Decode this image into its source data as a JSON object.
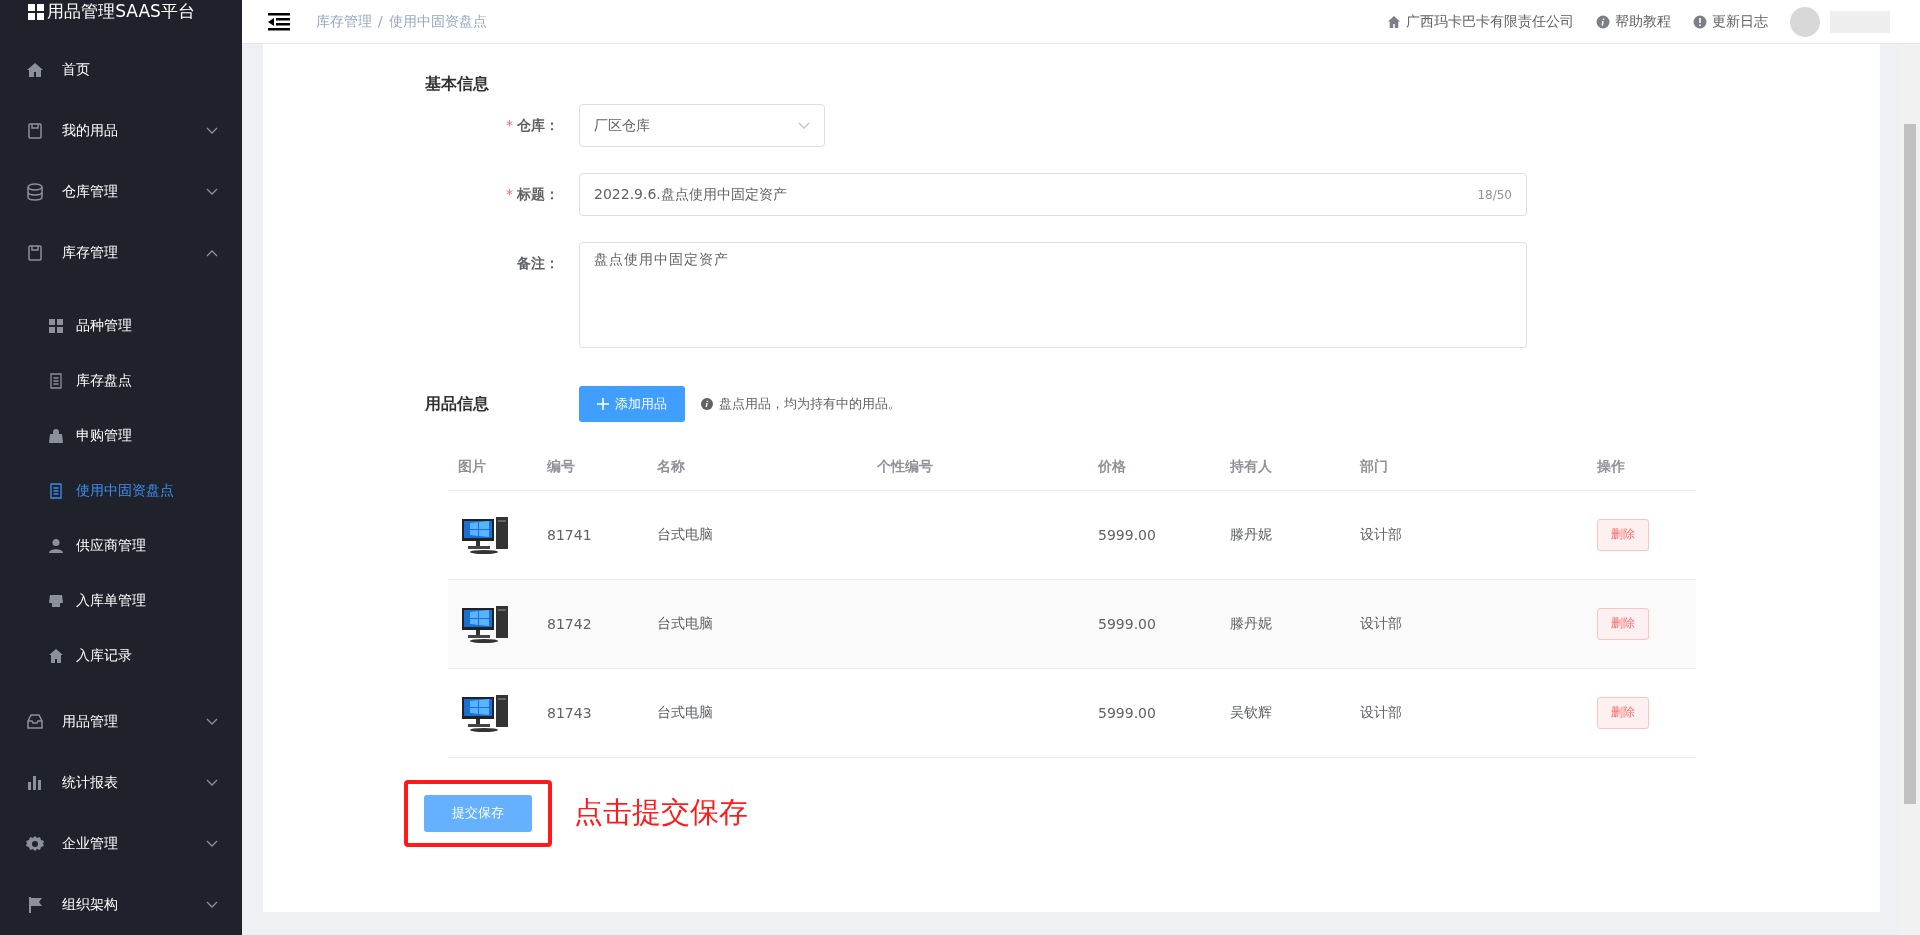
{
  "app": {
    "title": "用品管理SAAS平台"
  },
  "sidebar": {
    "items": [
      {
        "label": "首页",
        "kind": "link",
        "selected": false
      },
      {
        "label": "我的用品",
        "kind": "menu",
        "expanded": false
      },
      {
        "label": "仓库管理",
        "kind": "menu",
        "expanded": false
      },
      {
        "label": "库存管理",
        "kind": "menu",
        "expanded": true,
        "children": [
          {
            "label": "品种管理",
            "selected": false
          },
          {
            "label": "库存盘点",
            "selected": false
          },
          {
            "label": "申购管理",
            "selected": false
          },
          {
            "label": "使用中固资盘点",
            "selected": true
          },
          {
            "label": "供应商管理",
            "selected": false
          },
          {
            "label": "入库单管理",
            "selected": false
          },
          {
            "label": "入库记录",
            "selected": false
          }
        ]
      },
      {
        "label": "用品管理",
        "kind": "menu",
        "expanded": false
      },
      {
        "label": "统计报表",
        "kind": "menu",
        "expanded": false
      },
      {
        "label": "企业管理",
        "kind": "menu",
        "expanded": false
      },
      {
        "label": "组织架构",
        "kind": "menu",
        "expanded": false
      }
    ]
  },
  "header": {
    "breadcrumb": [
      "库存管理",
      "使用中固资盘点"
    ],
    "breadcrumb_separator": "/",
    "links": [
      "广西玛卡巴卡有限责任公司",
      "帮助教程",
      "更新日志"
    ]
  },
  "form": {
    "section_title": "基本信息",
    "fields": [
      {
        "kind": "select",
        "label": "仓库：",
        "required_mark": "*",
        "value": "厂区仓库"
      },
      {
        "kind": "input",
        "label": "标题：",
        "required_mark": "*",
        "value": "2022.9.6.盘点使用中固定资产",
        "counter": "18/50"
      },
      {
        "kind": "textarea",
        "label": "备注：",
        "value": "盘点使用中固定资产"
      }
    ]
  },
  "items": {
    "section_title": "用品信息",
    "add_button": "添加用品",
    "hint": "盘点用品，均为持有中的用品。",
    "table": {
      "columns": [
        "图片",
        "编号",
        "名称",
        "个性编号",
        "价格",
        "持有人",
        "部门",
        "操作"
      ],
      "rows": [
        {
          "code": "81741",
          "name": "台式电脑",
          "price": "5999.00",
          "holder": "滕丹妮",
          "department": "设计部",
          "action": "删除"
        },
        {
          "code": "81742",
          "name": "台式电脑",
          "price": "5999.00",
          "holder": "滕丹妮",
          "department": "设计部",
          "action": "删除"
        },
        {
          "code": "81743",
          "name": "台式电脑",
          "price": "5999.00",
          "holder": "吴钦辉",
          "department": "设计部",
          "action": "删除"
        }
      ]
    }
  },
  "submit_button": "提交保存",
  "annotation": {
    "text": "点击提交保存"
  }
}
